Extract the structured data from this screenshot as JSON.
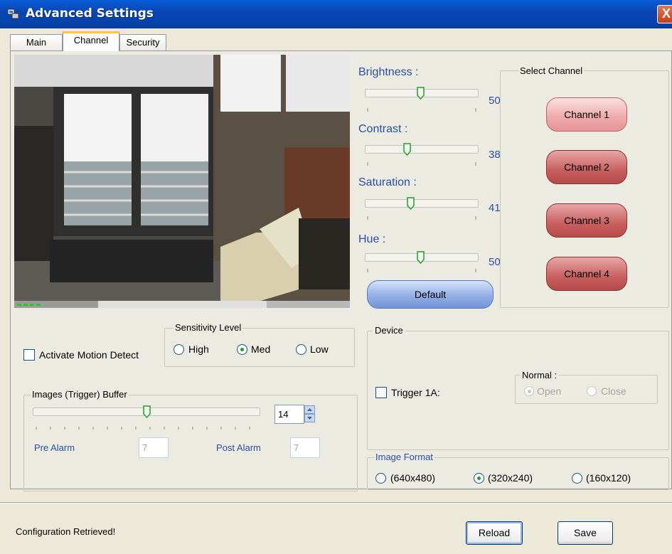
{
  "window": {
    "title": "Advanced Settings",
    "close_label": "X"
  },
  "tabs": [
    {
      "label": "Main"
    },
    {
      "label": "Channel",
      "active": true
    },
    {
      "label": "Security"
    }
  ],
  "video": {
    "icon": "camera-feed-image"
  },
  "adjustments": {
    "brightness": {
      "label": "Brightness :",
      "value": "50"
    },
    "contrast": {
      "label": "Contrast :",
      "value": "38"
    },
    "saturation": {
      "label": "Saturation :",
      "value": "41"
    },
    "hue": {
      "label": "Hue :",
      "value": "50"
    },
    "default_label": "Default"
  },
  "channels": {
    "legend": "Select Channel",
    "items": [
      {
        "label": "Channel 1",
        "selected": true
      },
      {
        "label": "Channel 2"
      },
      {
        "label": "Channel 3"
      },
      {
        "label": "Channel 4"
      }
    ]
  },
  "motion": {
    "activate_label": "Activate Motion Detect",
    "sensitivity": {
      "legend": "Sensitivity Level",
      "options": [
        "High",
        "Med",
        "Low"
      ],
      "selected": "Med"
    },
    "buffer": {
      "legend": "Images (Trigger) Buffer",
      "value": "14",
      "pre_label": "Pre Alarm",
      "pre_value": "7",
      "post_label": "Post Alarm",
      "post_value": "7"
    }
  },
  "device": {
    "legend": "Device",
    "trigger_label": "Trigger 1A:",
    "normal": {
      "legend": "Normal :",
      "options": [
        "Open",
        "Close"
      ],
      "selected": "Open"
    }
  },
  "image_format": {
    "legend": "Image Format",
    "options": [
      "(640x480)",
      "(320x240)",
      "(160x120)"
    ],
    "selected": "(320x240)"
  },
  "status": {
    "text": "Configuration Retrieved!"
  },
  "buttons": {
    "reload": "Reload",
    "save": "Save"
  },
  "colors": {
    "title_bar": "#0846b4",
    "label_blue": "#2a4fa8",
    "channel_red": "#c85f5f",
    "tab_accent": "#ffc83c"
  }
}
